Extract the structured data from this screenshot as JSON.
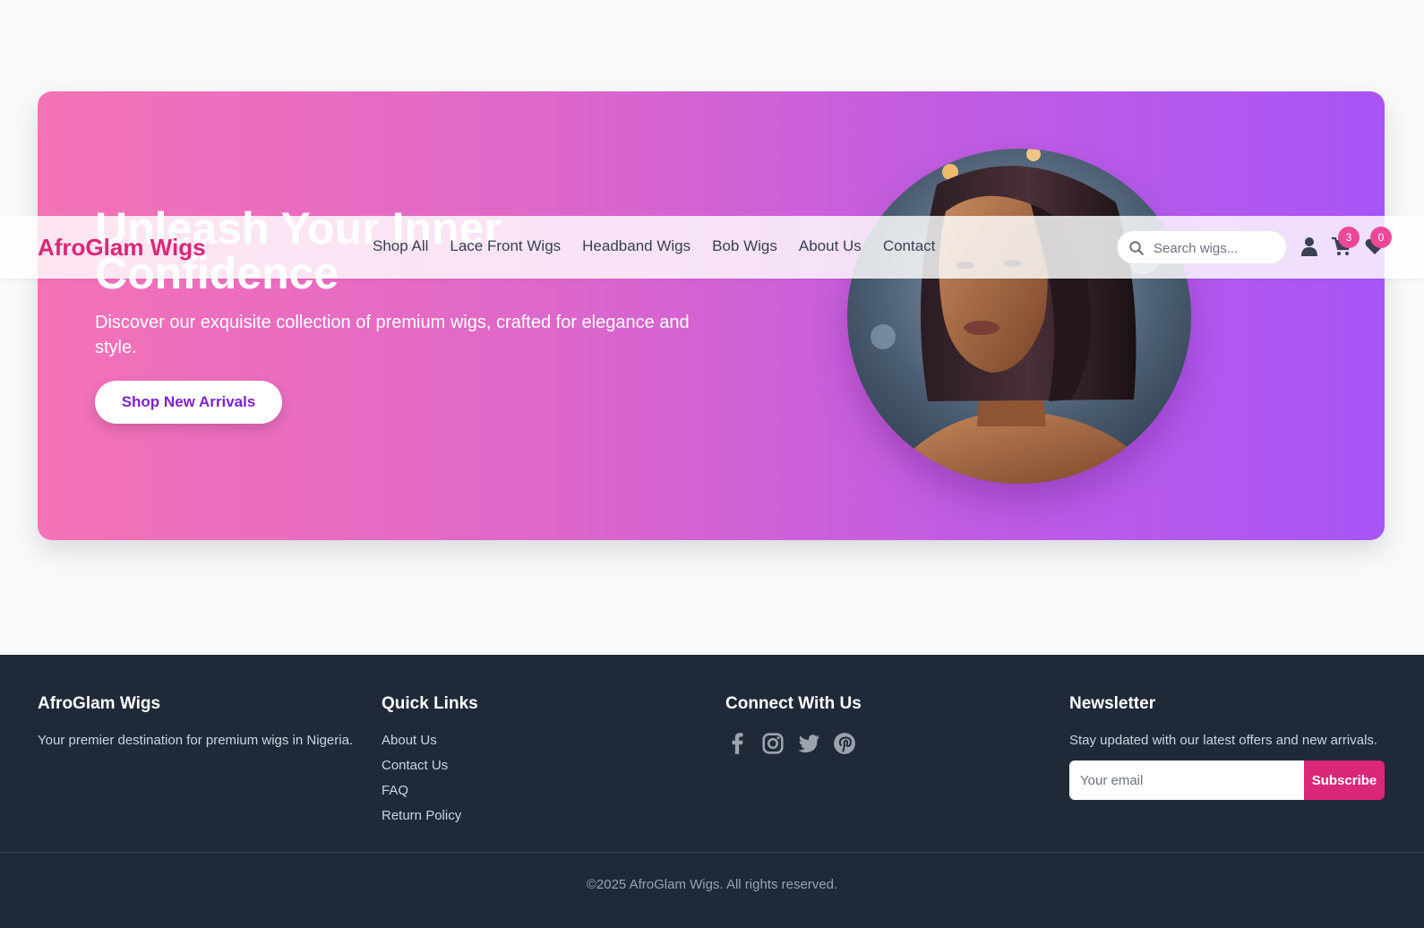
{
  "brand": {
    "name": "AfroGlam Wigs",
    "color": "#db2777"
  },
  "nav": {
    "links": [
      "Shop All",
      "Lace Front Wigs",
      "Headband Wigs",
      "Bob Wigs",
      "About Us",
      "Contact"
    ],
    "search_placeholder": "Search wigs...",
    "cart_count": "3",
    "wishlist_count": "0",
    "icons": [
      "search-icon",
      "user-icon",
      "cart-icon",
      "heart-icon"
    ]
  },
  "hero": {
    "title_line1": "Unleash Your Inner",
    "title_line2": "Confidence",
    "subtitle": "Discover our exquisite collection of premium wigs, crafted for elegance and style.",
    "cta": "Shop New Arrivals",
    "gradient": [
      "#f472b6",
      "#a855f7"
    ]
  },
  "footer": {
    "about": {
      "title": "AfroGlam Wigs",
      "text": "Your premier destination for premium wigs in Nigeria."
    },
    "quick_links": {
      "title": "Quick Links",
      "items": [
        "About Us",
        "Contact Us",
        "FAQ",
        "Return Policy"
      ]
    },
    "connect": {
      "title": "Connect With Us",
      "icons": [
        "facebook-icon",
        "instagram-icon",
        "twitter-icon",
        "pinterest-icon"
      ]
    },
    "newsletter": {
      "title": "Newsletter",
      "text": "Stay updated with our latest offers and new arrivals.",
      "placeholder": "Your email",
      "button": "Subscribe"
    },
    "copyright": "©2025 AfroGlam Wigs. All rights reserved.",
    "background": "#1f2937"
  }
}
